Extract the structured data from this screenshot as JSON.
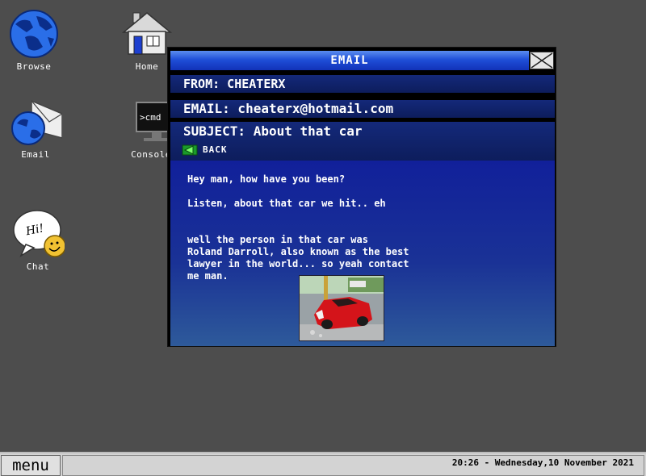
{
  "desktop": {
    "icons": [
      {
        "label": "Browse",
        "icon": "globe-icon"
      },
      {
        "label": "Home",
        "icon": "house-icon"
      },
      {
        "label": "Email",
        "icon": "email-globe-icon"
      },
      {
        "label": "Console",
        "icon": "console-icon",
        "glyph_text": ">cmd"
      },
      {
        "label": "Chat",
        "icon": "chat-bubble-icon",
        "glyph_text": "Hi!"
      }
    ]
  },
  "email_window": {
    "title": "EMAIL",
    "from": "FROM: CHEATERX",
    "email": "EMAIL: cheaterx@hotmail.com",
    "subject": "SUBJECT: About that car",
    "back_label": "BACK",
    "body": {
      "line1": "Hey man, how have you been?",
      "line2": "Listen, about that car we hit.. eh",
      "line3": "well the person in that car was\nRoland Darroll, also known as the best\nlawyer in the world... so yeah contact\nme man."
    },
    "photo": "wrecked-red-car-photo"
  },
  "taskbar": {
    "menu_label": "menu",
    "clock": "20:26 - Wednesday,10 November 2021"
  },
  "colors": {
    "desktop_bg": "#4d4d4d",
    "title_bar": "#1f4fd8",
    "header_rows": "#14297a",
    "body_bg": "#1a3296",
    "taskbar": "#d3d3d3"
  }
}
